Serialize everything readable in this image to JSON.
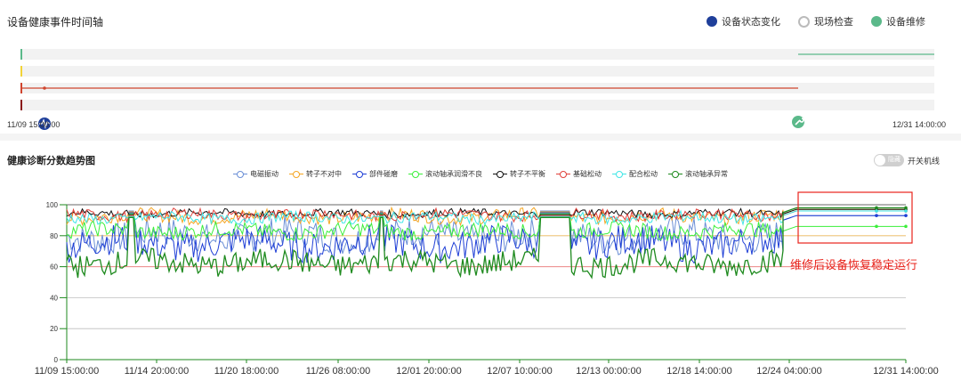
{
  "timeline": {
    "title": "设备健康事件时间轴",
    "legend": [
      {
        "label": "设备状态变化",
        "icon": "heartbeat-icon"
      },
      {
        "label": "现场检查",
        "icon": "inspection-icon"
      },
      {
        "label": "设备维修",
        "icon": "wrench-icon"
      }
    ],
    "start_label": "11/09 15:00:00",
    "end_label": "12/31 14:00:00"
  },
  "trend": {
    "title": "健康诊断分数趋势图",
    "toggle": {
      "state_label": "隐藏",
      "label": "开关机线"
    },
    "annotation": "维修后设备恢复稳定运行"
  },
  "chart_data": {
    "type": "line",
    "title": "健康诊断分数趋势图",
    "xlabel": "",
    "ylabel": "",
    "ylim": [
      0,
      100
    ],
    "yticks": [
      0,
      20,
      40,
      60,
      80,
      100
    ],
    "xticks": [
      "11/09 15:00:00",
      "11/14 20:00:00",
      "11/20 18:00:00",
      "11/26 08:00:00",
      "12/01 20:00:00",
      "12/07 10:00:00",
      "12/13 00:00:00",
      "12/18 14:00:00",
      "12/24 04:00:00",
      "12/31 14:00:00"
    ],
    "threshold_lines": [
      60,
      80
    ],
    "legend_position": "top-center",
    "grid": true,
    "series": [
      {
        "name": "电磁振动",
        "color": "#6b8fd6",
        "approx_range": [
          70,
          90
        ],
        "after_repair": 93
      },
      {
        "name": "转子不对中",
        "color": "#f5a623",
        "approx_range": [
          88,
          97
        ],
        "after_repair": 97
      },
      {
        "name": "部件碰磨",
        "color": "#1f3fd6",
        "approx_range": [
          65,
          85
        ],
        "after_repair": 93
      },
      {
        "name": "滚动轴承润滑不良",
        "color": "#3bef3b",
        "approx_range": [
          78,
          88
        ],
        "after_repair": 86
      },
      {
        "name": "转子不平衡",
        "color": "#111111",
        "approx_range": [
          92,
          97
        ],
        "after_repair": 97
      },
      {
        "name": "基础松动",
        "color": "#e0403a",
        "approx_range": [
          90,
          97
        ],
        "after_repair": 96
      },
      {
        "name": "配合松动",
        "color": "#40e6e6",
        "approx_range": [
          88,
          95
        ],
        "after_repair": 96
      },
      {
        "name": "滚动轴承异常",
        "color": "#1e8a1e",
        "approx_range": [
          55,
          70
        ],
        "after_repair": 98
      }
    ]
  }
}
